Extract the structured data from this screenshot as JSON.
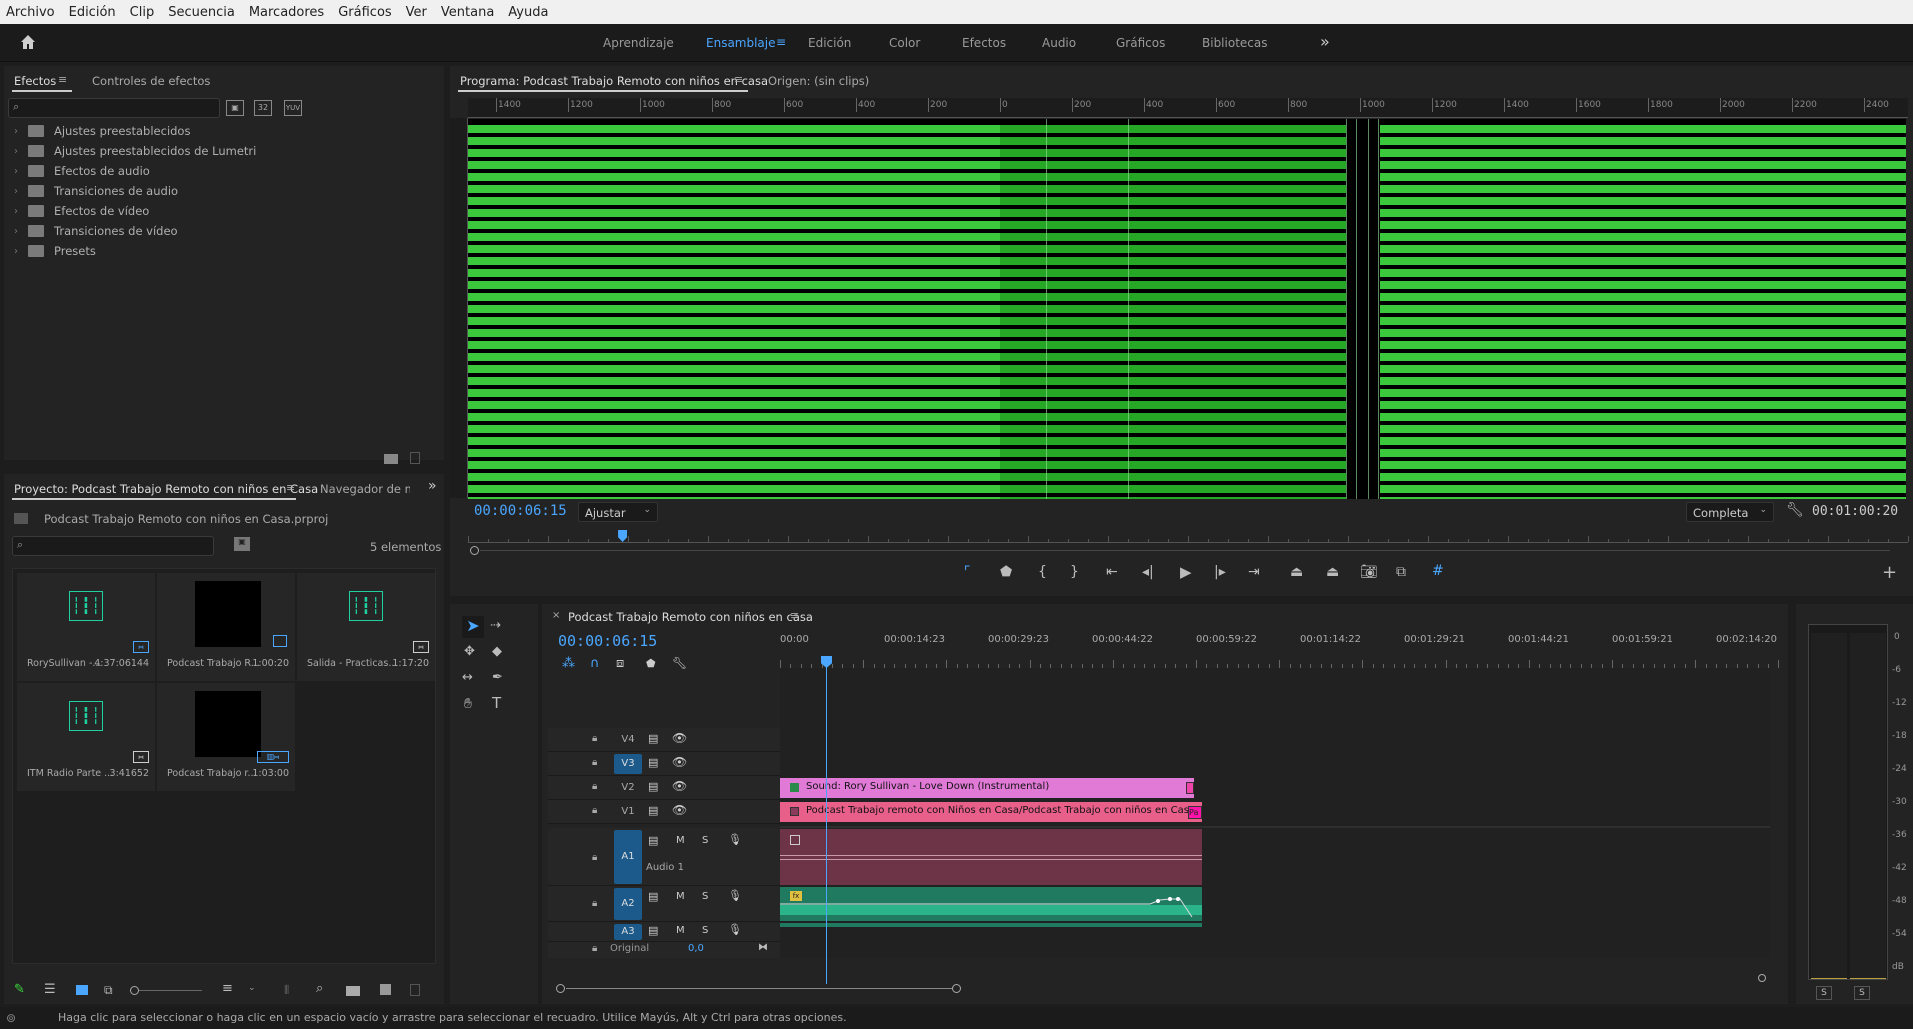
{
  "menu": [
    "Archivo",
    "Edición",
    "Clip",
    "Secuencia",
    "Marcadores",
    "Gráficos",
    "Ver",
    "Ventana",
    "Ayuda"
  ],
  "workspaces": [
    "Aprendizaje",
    "Ensamblaje",
    "Edición",
    "Color",
    "Efectos",
    "Audio",
    "Gráficos",
    "Bibliotecas"
  ],
  "workspace_active": "Ensamblaje",
  "effects_panel": {
    "tab_active": "Efectos",
    "tab_other": "Controles de efectos",
    "items": [
      "Ajustes preestablecidos",
      "Ajustes preestablecidos de Lumetri",
      "Efectos de audio",
      "Transiciones de audio",
      "Efectos de vídeo",
      "Transiciones de vídeo",
      "Presets"
    ]
  },
  "project_panel": {
    "tab_active": "Proyecto: Podcast Trabajo Remoto con niños en Casa",
    "tab_other": "Navegador de m",
    "project_file": "Podcast Trabajo Remoto con niños en Casa.prproj",
    "count": "5 elementos",
    "items": [
      {
        "name": "RorySullivan -...",
        "duration": "4:37:06144",
        "kind": "audio"
      },
      {
        "name": "Podcast Trabajo R...",
        "duration": "1:00:20",
        "kind": "video"
      },
      {
        "name": "Salida - Practicas...",
        "duration": "1:17:20",
        "kind": "audio"
      },
      {
        "name": "ITM Radio Parte ...",
        "duration": "3:41652",
        "kind": "audio"
      },
      {
        "name": "Podcast Trabajo r...",
        "duration": "1:03:00",
        "kind": "video"
      }
    ]
  },
  "program_monitor": {
    "tab_active": "Programa: Podcast Trabajo Remoto con niños en casa",
    "tab_other": "Origen: (sin clips)",
    "timecode": "00:00:06:15",
    "fit": "Ajustar",
    "resolution": "Completa",
    "duration": "00:01:00:20",
    "ruler_top": [
      "1400",
      "1200",
      "1000",
      "800",
      "600",
      "400",
      "200",
      "0",
      "200",
      "400",
      "600",
      "800",
      "1000",
      "1200",
      "1400",
      "1600",
      "1800",
      "2000",
      "2200",
      "2400"
    ],
    "playhead_fraction": 0.107
  },
  "timeline": {
    "tab": "Podcast Trabajo Remoto con niños en casa",
    "timecode": "00:00:06:15",
    "ruler": [
      "00:00",
      "00:00:14:23",
      "00:00:29:23",
      "00:00:44:22",
      "00:00:59:22",
      "00:01:14:22",
      "00:01:29:21",
      "00:01:44:21",
      "00:01:59:21",
      "00:02:14:20"
    ],
    "video_tracks": [
      "V4",
      "V3",
      "V2",
      "V1"
    ],
    "audio_tracks": [
      "A1",
      "A2",
      "A3"
    ],
    "audio1_name": "Audio 1",
    "track_buttons": {
      "mute": "M",
      "solo": "S"
    },
    "original_label": "Original",
    "original_value": "0,0",
    "clip_v2": "Sound: Rory Sullivan - Love Down (Instrumental)",
    "clip_v1": "Podcast Trabajo remoto con Niños en Casa/Podcast Trabajo con niños en Casa.aep [V]",
    "clip_v1_fx": "Pa",
    "clip_a2_fx": "fx"
  },
  "meter": {
    "labels": [
      "0",
      "-6",
      "-12",
      "-18",
      "-24",
      "-30",
      "-36",
      "-42",
      "-48",
      "-54",
      "dB"
    ],
    "solo_buttons": [
      "S",
      "S"
    ]
  },
  "status_bar": "Haga clic para seleccionar o haga clic en un espacio vacío y arrastre para seleccionar el recuadro. Utilice Mayús, Alt y Ctrl para otras opciones.",
  "colors": {
    "accent_blue": "#4aa6ff",
    "clip_pink": "#e07ad6",
    "clip_rose": "#e8608a",
    "audio_maroon": "#6c3446",
    "audio_green": "#1f9a78",
    "green_lines": "#3cc83c"
  }
}
